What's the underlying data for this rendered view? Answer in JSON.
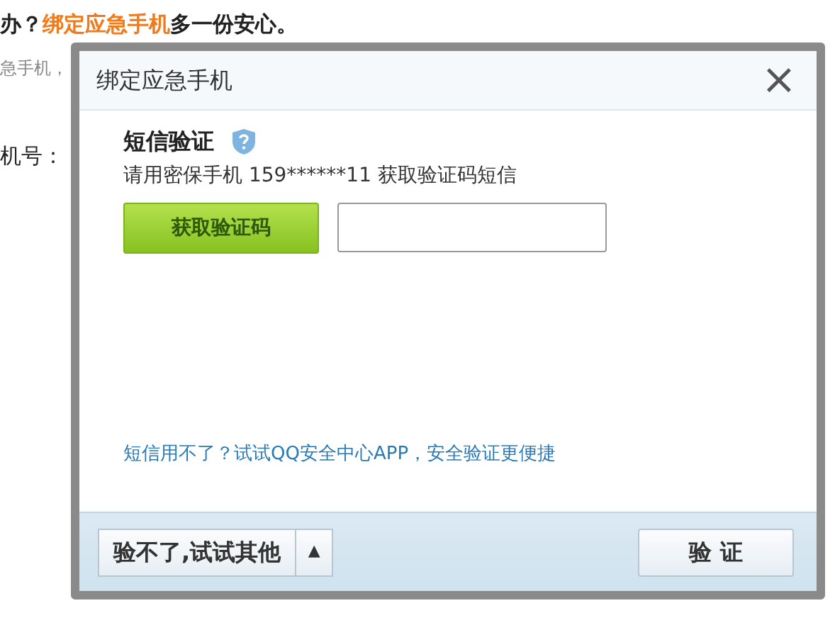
{
  "page": {
    "headline": [
      {
        "text": "办？",
        "kind": "plain"
      },
      {
        "text": "绑定应急手机",
        "kind": "highlight"
      },
      {
        "text": "多一份安心。",
        "kind": "plain"
      }
    ],
    "subline": "急手机，",
    "field_label": "机号："
  },
  "dialog": {
    "title": "绑定应急手机",
    "close": "×",
    "section_title": "短信验证",
    "instruction": "请用密保手机 159******11 获取验证码短信",
    "get_code_button": "获取验证码",
    "help_link": "短信用不了？试试QQ安全中心APP，安全验证更便捷",
    "other_button": "验不了,试试其他",
    "other_caret": "▲",
    "verify_button": "验 证"
  }
}
